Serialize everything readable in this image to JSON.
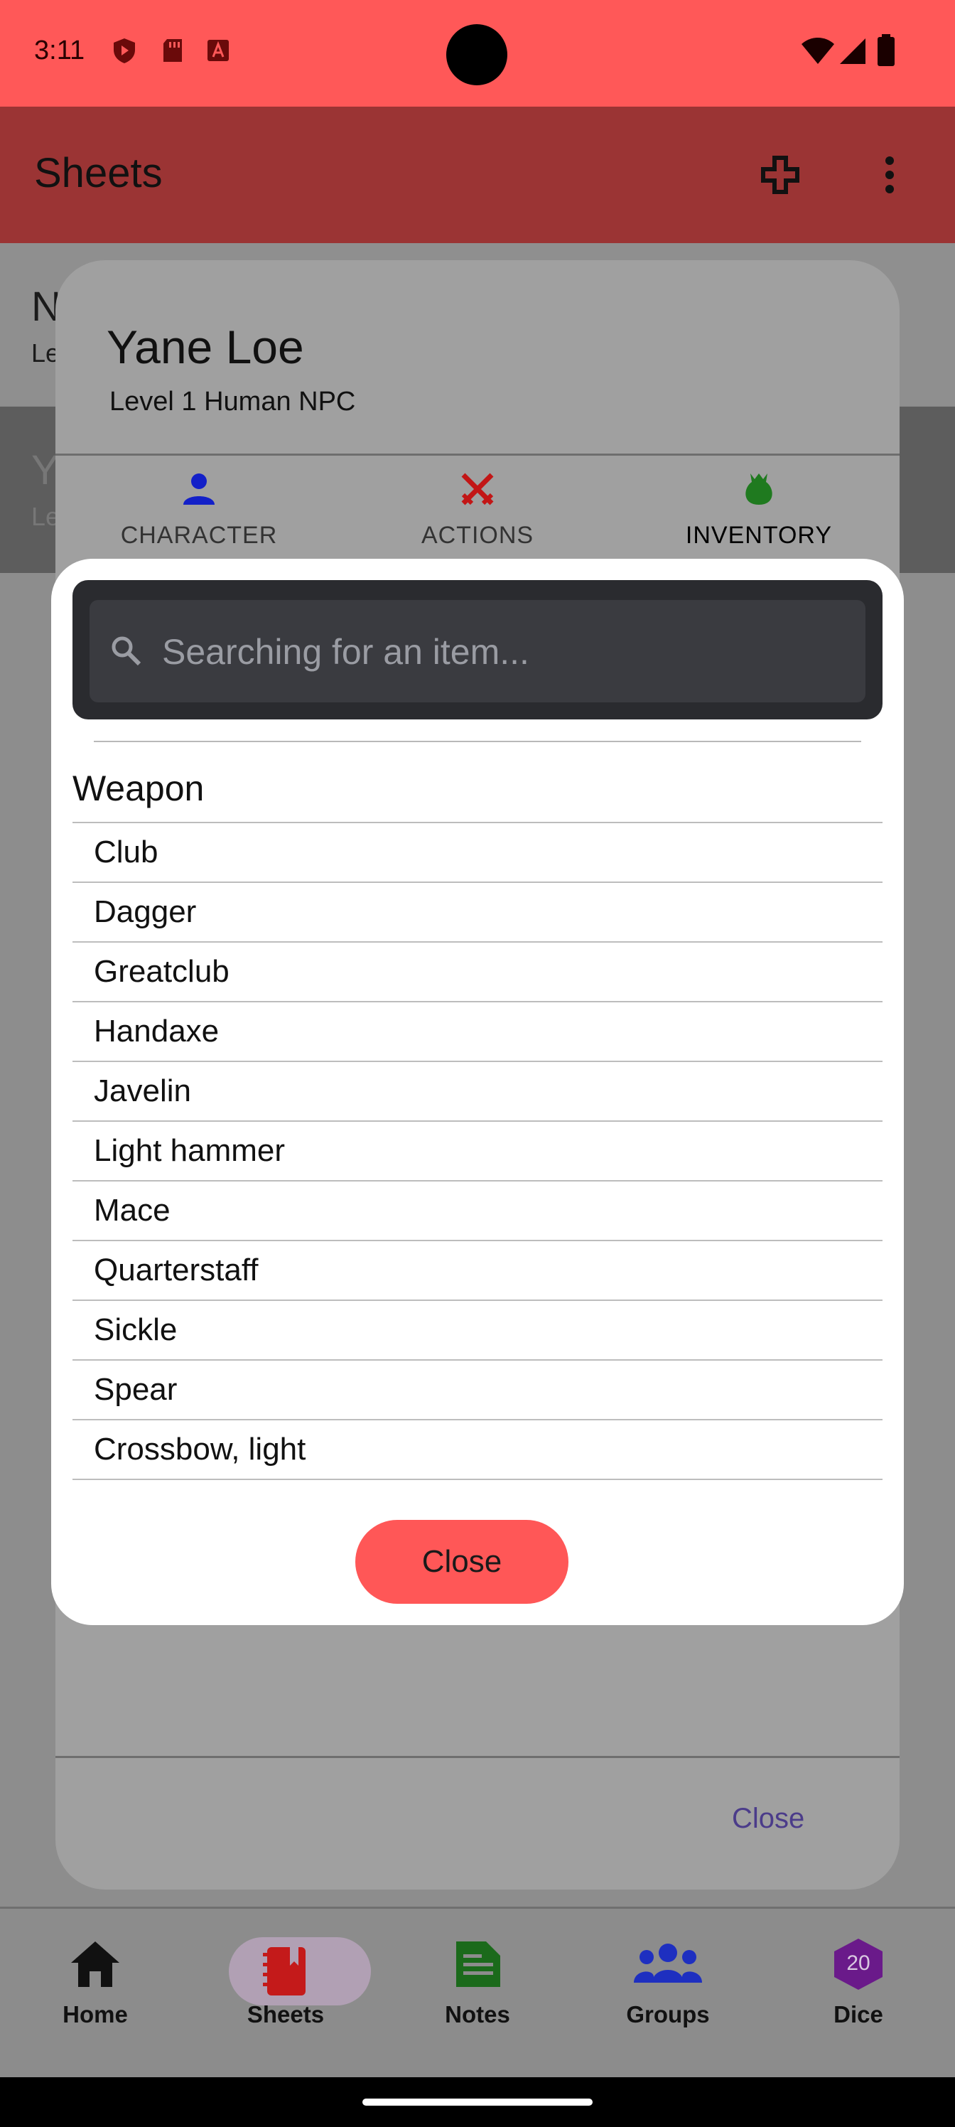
{
  "status_bar": {
    "time": "3:11"
  },
  "app_bar": {
    "title": "Sheets"
  },
  "background_list": {
    "row1": {
      "name": "N",
      "sub": "Le"
    },
    "row2": {
      "name": "Y",
      "sub": "Le"
    }
  },
  "sheet": {
    "name": "Yane Loe",
    "subtitle": "Level 1 Human NPC",
    "tabs": [
      {
        "label": "CHARACTER",
        "icon": "person-icon",
        "color": "#1320c8"
      },
      {
        "label": "ACTIONS",
        "icon": "crossed-swords-icon",
        "color": "#c21616"
      },
      {
        "label": "INVENTORY",
        "icon": "bag-icon",
        "color": "#1f7a1f"
      }
    ],
    "close_label": "Close"
  },
  "picker": {
    "search_placeholder": "Searching for an item...",
    "category": "Weapon",
    "items": [
      "Club",
      "Dagger",
      "Greatclub",
      "Handaxe",
      "Javelin",
      "Light hammer",
      "Mace",
      "Quarterstaff",
      "Sickle",
      "Spear",
      "Crossbow, light"
    ],
    "close_label": "Close"
  },
  "bottom_nav": [
    {
      "label": "Home",
      "icon": "home-icon",
      "color": "#111111"
    },
    {
      "label": "Sheets",
      "icon": "book-icon",
      "color": "#c41a1a",
      "selected": true
    },
    {
      "label": "Notes",
      "icon": "note-icon",
      "color": "#1b6a1b"
    },
    {
      "label": "Groups",
      "icon": "groups-icon",
      "color": "#1e2fc0"
    },
    {
      "label": "Dice",
      "icon": "d20-icon",
      "color": "#6a1a8a",
      "badge": "20"
    }
  ]
}
